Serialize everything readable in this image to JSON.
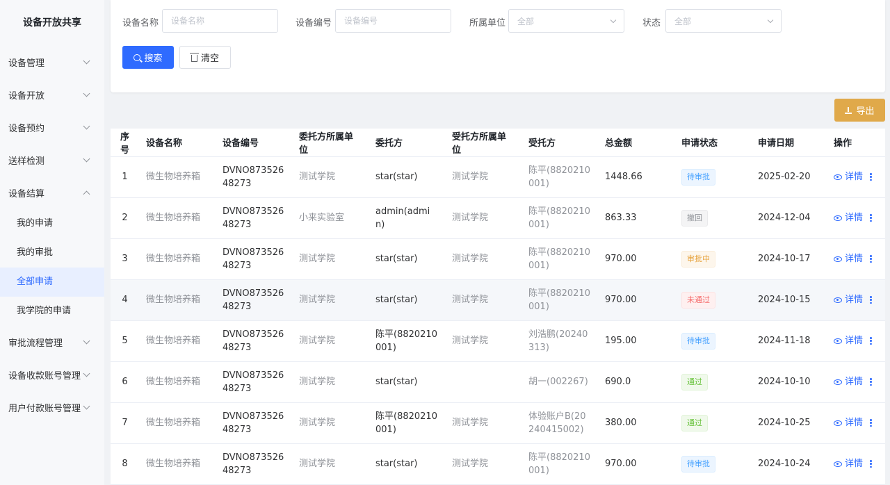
{
  "app": {
    "title": "设备开放共享"
  },
  "sidebar": {
    "items": [
      {
        "label": "设备管理",
        "expanded": false
      },
      {
        "label": "设备开放",
        "expanded": false
      },
      {
        "label": "设备预约",
        "expanded": false
      },
      {
        "label": "送样检测",
        "expanded": false
      },
      {
        "label": "设备结算",
        "expanded": true
      }
    ],
    "sub_items": [
      {
        "label": "我的申请"
      },
      {
        "label": "我的审批"
      },
      {
        "label": "全部申请",
        "active": true
      },
      {
        "label": "我学院的申请"
      }
    ],
    "items_after": [
      {
        "label": "审批流程管理"
      },
      {
        "label": "设备收款账号管理"
      },
      {
        "label": "用户付款账号管理"
      }
    ]
  },
  "search": {
    "device_name": {
      "label": "设备名称",
      "placeholder": "设备名称"
    },
    "device_code": {
      "label": "设备编号",
      "placeholder": "设备编号"
    },
    "unit": {
      "label": "所属单位",
      "value": "全部"
    },
    "status": {
      "label": "状态",
      "value": "全部"
    },
    "search_button": "搜索",
    "clear_button": "清空"
  },
  "toolbar": {
    "export_label": "导出"
  },
  "table": {
    "headers": [
      "序号",
      "设备名称",
      "设备编号",
      "委托方所属单位",
      "委托方",
      "受托方所属单位",
      "受托方",
      "总金额",
      "申请状态",
      "申请日期",
      "操作"
    ],
    "detail_label": "详情",
    "rows": [
      {
        "no": "1",
        "device": "微生物培养箱",
        "code": "DVNO87352648273",
        "client_unit": "测试学院",
        "client": "star(star)",
        "trustee_unit": "测试学院",
        "trustee": "陈平(8820210001)",
        "amount": "1448.66",
        "status": "待审批",
        "status_color": "blue",
        "date": "2025-02-20"
      },
      {
        "no": "2",
        "device": "微生物培养箱",
        "code": "DVNO87352648273",
        "client_unit": "小来实验室",
        "client": "admin(admin)",
        "trustee_unit": "测试学院",
        "trustee": "陈平(8820210001)",
        "amount": "863.33",
        "status": "撤回",
        "status_color": "gray",
        "date": "2024-12-04"
      },
      {
        "no": "3",
        "device": "微生物培养箱",
        "code": "DVNO87352648273",
        "client_unit": "测试学院",
        "client": "star(star)",
        "trustee_unit": "测试学院",
        "trustee": "陈平(8820210001)",
        "amount": "970.00",
        "status": "审批中",
        "status_color": "orange",
        "date": "2024-10-17"
      },
      {
        "no": "4",
        "device": "微生物培养箱",
        "code": "DVNO87352648273",
        "client_unit": "测试学院",
        "client": "star(star)",
        "trustee_unit": "测试学院",
        "trustee": "陈平(8820210001)",
        "amount": "970.00",
        "status": "未通过",
        "status_color": "red",
        "date": "2024-10-15"
      },
      {
        "no": "5",
        "device": "微生物培养箱",
        "code": "DVNO87352648273",
        "client_unit": "测试学院",
        "client": "陈平(8820210001)",
        "trustee_unit": "测试学院",
        "trustee": "刘浩鹏(20240313)",
        "amount": "195.00",
        "status": "待审批",
        "status_color": "blue",
        "date": "2024-11-18"
      },
      {
        "no": "6",
        "device": "微生物培养箱",
        "code": "DVNO87352648273",
        "client_unit": "测试学院",
        "client": "star(star)",
        "trustee_unit": "",
        "trustee": "胡一(002267)",
        "amount": "690.0",
        "status": "通过",
        "status_color": "green",
        "date": "2024-10-10"
      },
      {
        "no": "7",
        "device": "微生物培养箱",
        "code": "DVNO87352648273",
        "client_unit": "测试学院",
        "client": "陈平(8820210001)",
        "trustee_unit": "测试学院",
        "trustee": "体验账户B(20240415002)",
        "amount": "380.00",
        "status": "通过",
        "status_color": "green",
        "date": "2024-10-25"
      },
      {
        "no": "8",
        "device": "微生物培养箱",
        "code": "DVNO87352648273",
        "client_unit": "测试学院",
        "client": "star(star)",
        "trustee_unit": "测试学院",
        "trustee": "陈平(8820210001)",
        "amount": "970.00",
        "status": "待审批",
        "status_color": "blue",
        "date": "2024-10-24"
      }
    ]
  }
}
